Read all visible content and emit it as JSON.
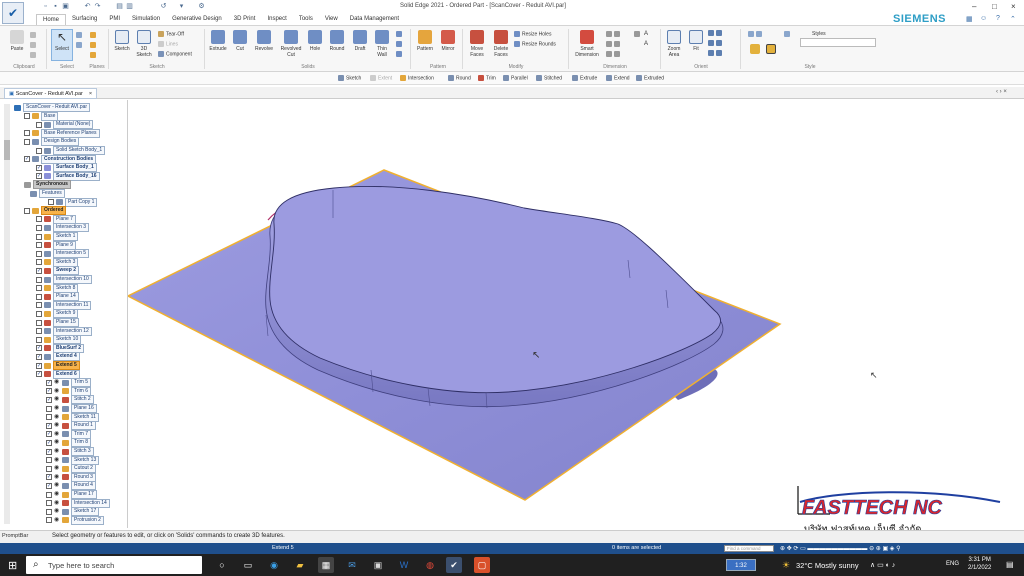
{
  "app": {
    "title": "Solid Edge 2021 - Ordered Part - [ScanCover - Reduit AVI.par]",
    "brand": "SIEMENS"
  },
  "tabs": [
    "Home",
    "Surfacing",
    "PMI",
    "Simulation",
    "Generative Design",
    "3D Print",
    "Inspect",
    "Tools",
    "View",
    "Data Management"
  ],
  "ribbon": {
    "clipboard": {
      "paste": "Paste",
      "group": "Clipboard"
    },
    "select": {
      "label": "Select",
      "group": "Select"
    },
    "planes": {
      "group": "Planes"
    },
    "sketch": {
      "sketch": "Sketch",
      "sketch3d": "3D Sketch",
      "tearoff": "Tear-Off",
      "lines": "Lines",
      "component": "Component",
      "group": "Sketch"
    },
    "solids": {
      "extrude": "Extrude",
      "cut": "Cut",
      "revolve": "Revolve",
      "revolved_cut": "Revolved Cut",
      "hole": "Hole",
      "round": "Round",
      "draft": "Draft",
      "thin_wall": "Thin Wall",
      "group": "Solids"
    },
    "pattern": {
      "pattern": "Pattern",
      "mirror": "Mirror",
      "group": "Pattern"
    },
    "modify": {
      "move_faces": "Move Faces",
      "delete_faces": "Delete Faces",
      "resize_holes": "Resize Holes",
      "resize_rounds": "Resize Rounds",
      "group": "Modify"
    },
    "dimension": {
      "smart": "Smart Dimension",
      "group": "Dimension"
    },
    "orient": {
      "zoom_area": "Zoom Area",
      "fit": "Fit",
      "group": "Orient"
    },
    "style": {
      "styles": "Styles",
      "group": "Style"
    }
  },
  "cmdbar": [
    "Sketch",
    "Extent",
    "Intersection",
    "Round",
    "Trim",
    "Parallel",
    "Stitched",
    "Extrude",
    "Extend",
    "Extruded"
  ],
  "doc_tab": "ScanCover - Reduit AVI.par",
  "tree": [
    {
      "label": "ScanCover - Reduit AVI.par",
      "style": ""
    },
    {
      "label": "Base",
      "style": ""
    },
    {
      "label": "Material (None)",
      "style": ""
    },
    {
      "label": "Base Reference Planes",
      "style": ""
    },
    {
      "label": "Design Bodies",
      "style": ""
    },
    {
      "label": "Solid Sketch Body_1",
      "style": ""
    },
    {
      "label": "Construction Bodies",
      "style": "bold"
    },
    {
      "label": "Surface Body_1",
      "style": "bold"
    },
    {
      "label": "Surface Body_16",
      "style": "bold"
    },
    {
      "label": "Synchronous",
      "style": "gray"
    },
    {
      "label": "Features",
      "style": ""
    },
    {
      "label": "Part Copy 1",
      "style": ""
    },
    {
      "label": "Ordered",
      "style": "hl"
    },
    {
      "label": "Plane 7",
      "style": ""
    },
    {
      "label": "Intersection 3",
      "style": ""
    },
    {
      "label": "Sketch 1",
      "style": ""
    },
    {
      "label": "Plane 9",
      "style": ""
    },
    {
      "label": "Intersection 5",
      "style": ""
    },
    {
      "label": "Sketch 3",
      "style": ""
    },
    {
      "label": "Sweep 2",
      "style": "bold"
    },
    {
      "label": "Intersection 10",
      "style": ""
    },
    {
      "label": "Sketch 8",
      "style": ""
    },
    {
      "label": "Plane 14",
      "style": ""
    },
    {
      "label": "Intersection 11",
      "style": ""
    },
    {
      "label": "Sketch 9",
      "style": ""
    },
    {
      "label": "Plane 15",
      "style": ""
    },
    {
      "label": "Intersection 12",
      "style": ""
    },
    {
      "label": "Sketch 10",
      "style": ""
    },
    {
      "label": "BlueSurf 2",
      "style": "bold"
    },
    {
      "label": "Extend 4",
      "style": "bold"
    },
    {
      "label": "Extend 5",
      "style": "hl"
    },
    {
      "label": "Extend 6",
      "style": "bold"
    },
    {
      "label": "Trim 5",
      "style": ""
    },
    {
      "label": "Trim 6",
      "style": ""
    },
    {
      "label": "Stitch 2",
      "style": ""
    },
    {
      "label": "Plane 16",
      "style": ""
    },
    {
      "label": "Sketch 11",
      "style": ""
    },
    {
      "label": "Round 1",
      "style": ""
    },
    {
      "label": "Trim 7",
      "style": ""
    },
    {
      "label": "Trim 8",
      "style": ""
    },
    {
      "label": "Stitch 3",
      "style": ""
    },
    {
      "label": "Sketch 13",
      "style": ""
    },
    {
      "label": "Cutout 2",
      "style": ""
    },
    {
      "label": "Round 3",
      "style": ""
    },
    {
      "label": "Round 4",
      "style": ""
    },
    {
      "label": "Plane 17",
      "style": ""
    },
    {
      "label": "Intersection 14",
      "style": ""
    },
    {
      "label": "Sketch 17",
      "style": ""
    },
    {
      "label": "Protrusion 2",
      "style": ""
    }
  ],
  "prompt": {
    "label": "PromptBar",
    "text": "Select geometry or features to edit, or click on 'Solids' commands to create 3D features."
  },
  "status": {
    "left": "Extend 5",
    "mid": "0 items are selected",
    "find": "Find a command"
  },
  "logo": {
    "brand": "FASTTECH NC",
    "thai": "บริษัท  ฟาสท์เทค  เอ็นซี  จำกัด"
  },
  "taskbar": {
    "search_placeholder": "Type here to search",
    "time_badge": "1:32",
    "weather": "32°C  Mostly sunny",
    "lang": "ENG",
    "time": "3:31 PM",
    "date": "2/1/2022"
  },
  "colors": {
    "surface": "#8f8fd8",
    "edge": "#f0b030",
    "statusbar": "#1f4f8c"
  }
}
